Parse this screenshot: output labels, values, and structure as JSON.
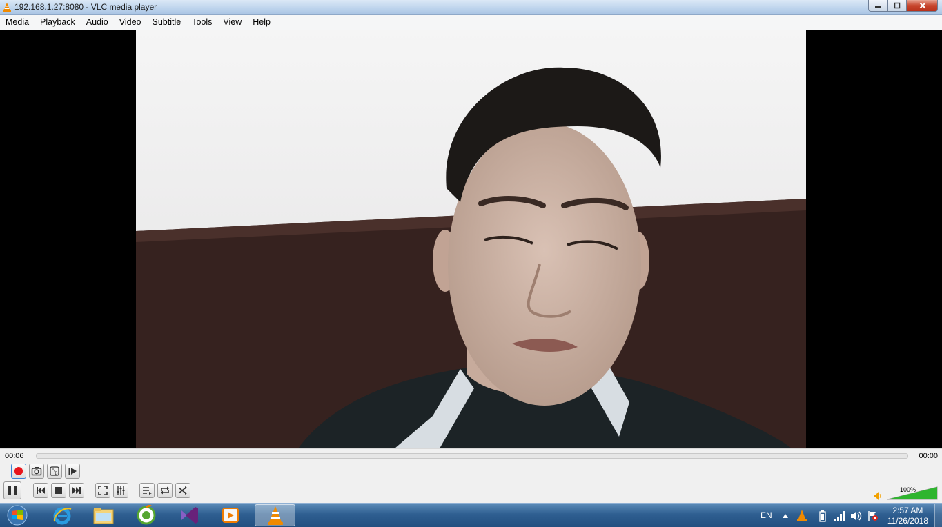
{
  "window": {
    "title": "192.168.1.27:8080 - VLC media player",
    "controls": {
      "minimize": "minimize-icon",
      "maximize": "maximize-icon",
      "close": "close-icon"
    }
  },
  "menu": [
    "Media",
    "Playback",
    "Audio",
    "Video",
    "Subtitle",
    "Tools",
    "View",
    "Help"
  ],
  "player": {
    "elapsed": "00:06",
    "total": "00:00",
    "seek_progress": 0.0,
    "volume_label": "100%",
    "volume_level": 1.0,
    "buttons_row1": [
      "record-icon",
      "snapshot-icon",
      "loop-ab-icon",
      "frame-by-frame-icon"
    ],
    "buttons_row2": [
      "pause-icon",
      "previous-icon",
      "stop-icon",
      "next-icon",
      "fullscreen-icon",
      "extended-settings-icon",
      "playlist-icon",
      "loop-icon",
      "shuffle-icon"
    ],
    "colors": {
      "record": "#e8141b",
      "volume": "#2fb52f",
      "accent_orange": "#f07c00"
    }
  },
  "taskbar": {
    "start": "windows-start-icon",
    "pinned": [
      "internet-explorer-icon",
      "file-explorer-icon",
      "coccoc-browser-icon",
      "visual-studio-icon",
      "media-player-icon",
      "vlc-icon"
    ],
    "tray": {
      "language": "EN",
      "icons": [
        "show-hidden-icons-icon",
        "vlc-tray-icon",
        "battery-icon",
        "network-signal-icon",
        "volume-icon",
        "action-center-flag-icon"
      ],
      "time": "2:57 AM",
      "date": "11/26/2018"
    }
  }
}
